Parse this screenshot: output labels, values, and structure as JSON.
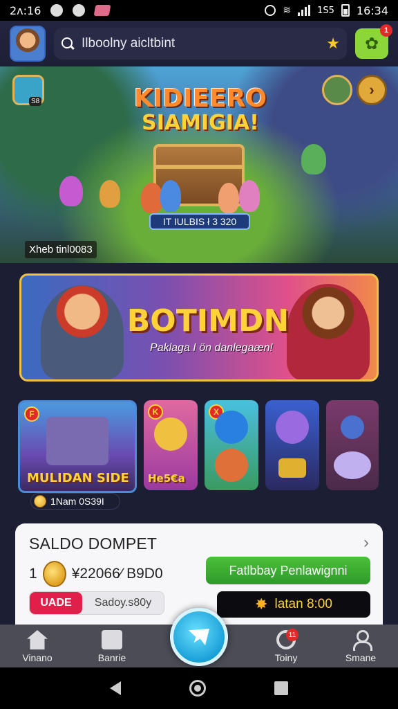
{
  "status_bar": {
    "time": "2ʌ:16",
    "right_text": "1S5",
    "clock": "16:34"
  },
  "top_bar": {
    "search_text": "Ilboolny aicltbint",
    "gift_badge": "1",
    "icons": [
      "avatar",
      "search-icon",
      "star-icon",
      "gift-icon"
    ]
  },
  "hero": {
    "title_line1": "KIDIEERO",
    "title_line2": "SIAMIGIA!",
    "chip_label": "S8",
    "timer": "IT IULBIS ł 3 320",
    "caption": "Xheb tinl0083"
  },
  "promo": {
    "title": "BOTIMDN",
    "subtitle": "Paklaga I ön danlegaæn!"
  },
  "games": {
    "cards": [
      {
        "label": "MULIDAN SIDE",
        "badge": "F"
      },
      {
        "label": "He5€a",
        "badge": "K"
      },
      {
        "label": "",
        "badge": "X"
      },
      {
        "label": "",
        "badge": ""
      },
      {
        "label": "",
        "badge": ""
      }
    ],
    "featured_footer": "1Nam 0S39I"
  },
  "wallet": {
    "title": "SALDO DOMPET",
    "prefix": "1",
    "amount": "¥22066⁄ B9D0",
    "action_button": "Fatlbbay Penlawignni",
    "tag": "UADE",
    "pill_text": "Sadoy.s80y",
    "dark_button": "latan 8:00"
  },
  "bottom_nav": {
    "items": [
      {
        "label": "Vinano"
      },
      {
        "label": "Banrie"
      },
      {
        "label": "Toiny",
        "badge": "11"
      },
      {
        "label": "Smane"
      }
    ]
  },
  "colors": {
    "accent_green": "#2e9a2a",
    "accent_red": "#e0204a",
    "gold": "#ffd23a",
    "fab_blue": "#1aa0d8"
  }
}
